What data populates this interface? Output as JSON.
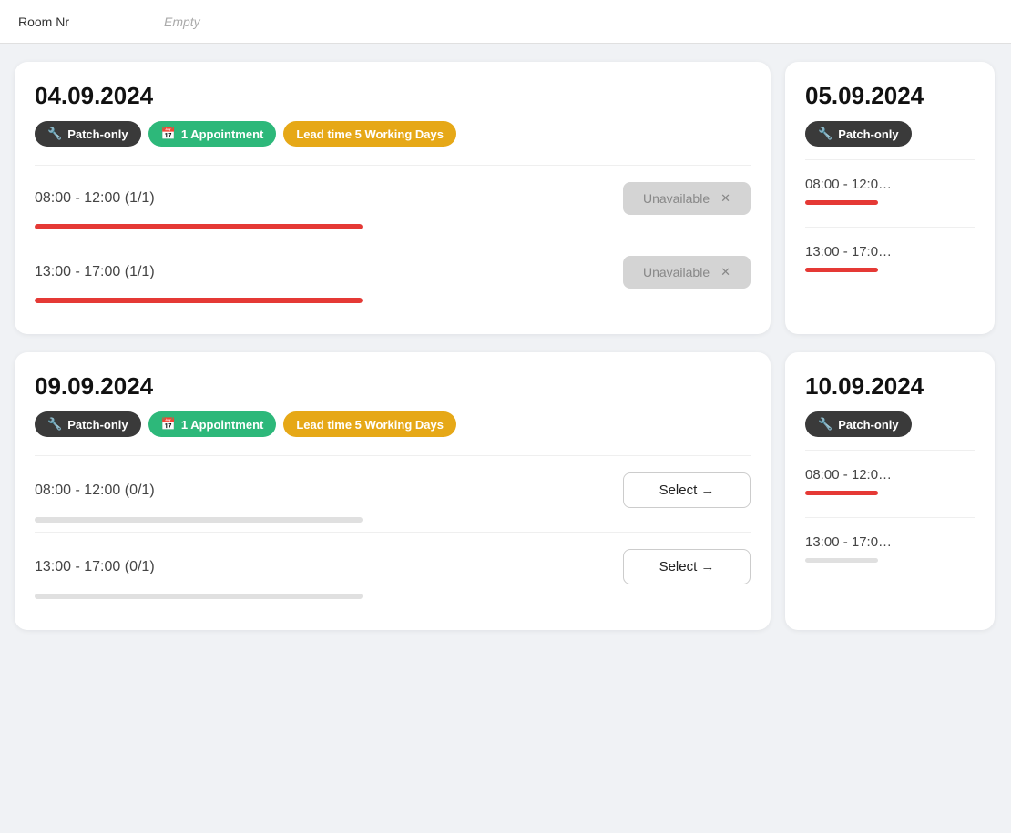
{
  "topBar": {
    "roomNrLabel": "Room Nr",
    "roomNrValue": "Empty"
  },
  "cards": [
    {
      "id": "card-04-09-2024",
      "date": "04.09.2024",
      "badges": [
        {
          "type": "dark",
          "icon": "wrench",
          "label": "Patch-only"
        },
        {
          "type": "green",
          "icon": "calendar",
          "label": "1 Appointment"
        },
        {
          "type": "yellow",
          "icon": "",
          "label": "Lead time 5 Working Days"
        }
      ],
      "slots": [
        {
          "time": "08:00 - 12:00 (1/1)",
          "buttonType": "unavailable",
          "buttonLabel": "Unavailable",
          "progressFull": true
        },
        {
          "time": "13:00 - 17:00 (1/1)",
          "buttonType": "unavailable",
          "buttonLabel": "Unavailable",
          "progressFull": true
        }
      ]
    },
    {
      "id": "card-09-09-2024",
      "date": "09.09.2024",
      "badges": [
        {
          "type": "dark",
          "icon": "wrench",
          "label": "Patch-only"
        },
        {
          "type": "green",
          "icon": "calendar",
          "label": "1 Appointment"
        },
        {
          "type": "yellow",
          "icon": "",
          "label": "Lead time 5 Working Days"
        }
      ],
      "slots": [
        {
          "time": "08:00 - 12:00 (0/1)",
          "buttonType": "select",
          "buttonLabel": "Select →",
          "progressFull": false
        },
        {
          "time": "13:00 - 17:00 (0/1)",
          "buttonType": "select",
          "buttonLabel": "Select →",
          "progressFull": false
        }
      ]
    }
  ],
  "partialCards": [
    {
      "id": "partial-05-09-2024",
      "date": "05.09.2024",
      "badgeLabel": "Patch-only",
      "slots": [
        {
          "time": "08:00 - 12:0…",
          "progressFull": true
        },
        {
          "time": "13:00 - 17:0…",
          "progressFull": true
        }
      ]
    },
    {
      "id": "partial-10-09-2024",
      "date": "10.09.2024",
      "badgeLabel": "Patch-only",
      "slots": [
        {
          "time": "08:00 - 12:0…",
          "progressFull": true
        },
        {
          "time": "13:00 - 17:0…",
          "progressFull": false
        }
      ]
    }
  ],
  "icons": {
    "wrench": "🔧",
    "calendar": "📅",
    "arrow_right": "→",
    "close": "✕"
  }
}
